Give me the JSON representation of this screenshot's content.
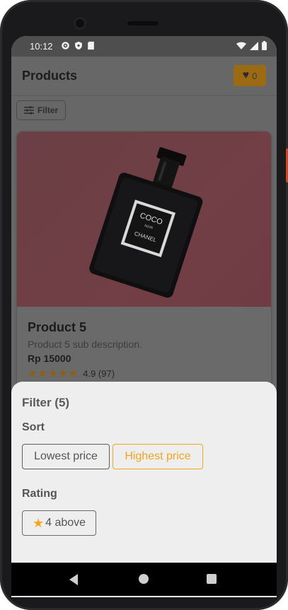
{
  "status_bar": {
    "time": "10:12",
    "left_icons": [
      "gear-icon",
      "shield-icon",
      "sd-card-icon"
    ],
    "right_icons": [
      "wifi-icon",
      "signal-icon",
      "battery-icon"
    ]
  },
  "app_bar": {
    "title": "Products",
    "wishlist_count": "0",
    "wishlist_icon": "heart-icon"
  },
  "toolbar": {
    "filter_label": "Filter",
    "filter_icon": "sliders-icon"
  },
  "product_card": {
    "title": "Product 5",
    "subtitle": "Product 5 sub description.",
    "price": "Rp 15000",
    "stars": "★★★★★",
    "rating_text": "4.9 (97)",
    "rating_value": 4.9,
    "image_text_top": "COCO",
    "image_text_mid": "NOIR",
    "image_text_bottom": "CHANEL"
  },
  "filter_sheet": {
    "title": "Filter (5)",
    "sort_label": "Sort",
    "sort_options": [
      "Lowest price",
      "Highest price"
    ],
    "sort_selected": "Highest price",
    "rating_label": "Rating",
    "rating_option": "4 above"
  },
  "colors": {
    "accent": "#f2a71d",
    "scrim": "#676767",
    "sheet_bg": "#eeeeee"
  },
  "nav_bar": {
    "icons": [
      "back-icon",
      "home-icon",
      "recents-icon"
    ]
  }
}
